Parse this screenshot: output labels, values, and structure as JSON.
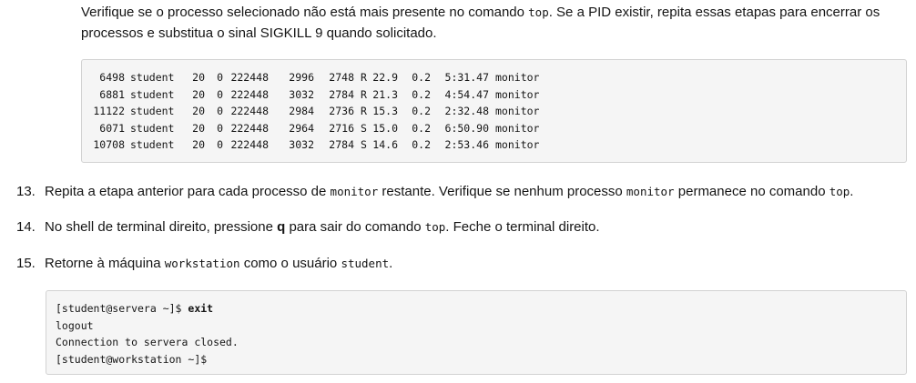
{
  "intro": {
    "part1": "Verifique se o processo selecionado não está mais presente no comando ",
    "code1": "top",
    "part2": ". Se a PID existir, repita essas etapas para encerrar os processos e substitua o sinal SIGKILL 9 quando solicitado."
  },
  "process_table": [
    {
      "pid": "6498",
      "user": "student",
      "pr": "20",
      "ni": "0",
      "virt": "222448",
      "res": "2996",
      "shr": "2748",
      "s": "R",
      "cpu": "22.9",
      "mem": "0.2",
      "time": "5:31.47",
      "command": "monitor"
    },
    {
      "pid": "6881",
      "user": "student",
      "pr": "20",
      "ni": "0",
      "virt": "222448",
      "res": "3032",
      "shr": "2784",
      "s": "R",
      "cpu": "21.3",
      "mem": "0.2",
      "time": "4:54.47",
      "command": "monitor"
    },
    {
      "pid": "11122",
      "user": "student",
      "pr": "20",
      "ni": "0",
      "virt": "222448",
      "res": "2984",
      "shr": "2736",
      "s": "R",
      "cpu": "15.3",
      "mem": "0.2",
      "time": "2:32.48",
      "command": "monitor"
    },
    {
      "pid": "6071",
      "user": "student",
      "pr": "20",
      "ni": "0",
      "virt": "222448",
      "res": "2964",
      "shr": "2716",
      "s": "S",
      "cpu": "15.0",
      "mem": "0.2",
      "time": "6:50.90",
      "command": "monitor"
    },
    {
      "pid": "10708",
      "user": "student",
      "pr": "20",
      "ni": "0",
      "virt": "222448",
      "res": "3032",
      "shr": "2784",
      "s": "S",
      "cpu": "14.6",
      "mem": "0.2",
      "time": "2:53.46",
      "command": "monitor"
    }
  ],
  "steps": [
    {
      "number": "13.",
      "t1": "Repita a etapa anterior para cada processo de ",
      "c1": "monitor",
      "t2": " restante. Verifique se nenhum processo ",
      "c2": "monitor",
      "t3": " permanece no comando ",
      "c3": "top",
      "t4": "."
    },
    {
      "number": "14.",
      "t1": "No shell de terminal direito, pressione ",
      "key": "q",
      "t2": " para sair do comando ",
      "c1": "top",
      "t3": ". Feche o terminal direito."
    },
    {
      "number": "15.",
      "t1": "Retorne à máquina ",
      "c1": "workstation",
      "t2": " como o usuário ",
      "c2": "student",
      "t3": "."
    }
  ],
  "terminal": {
    "prompt1": "[student@servera ~]$ ",
    "cmd1": "exit",
    "line2": "logout",
    "line3": "Connection to servera closed.",
    "prompt4": "[student@workstation ~]$"
  }
}
